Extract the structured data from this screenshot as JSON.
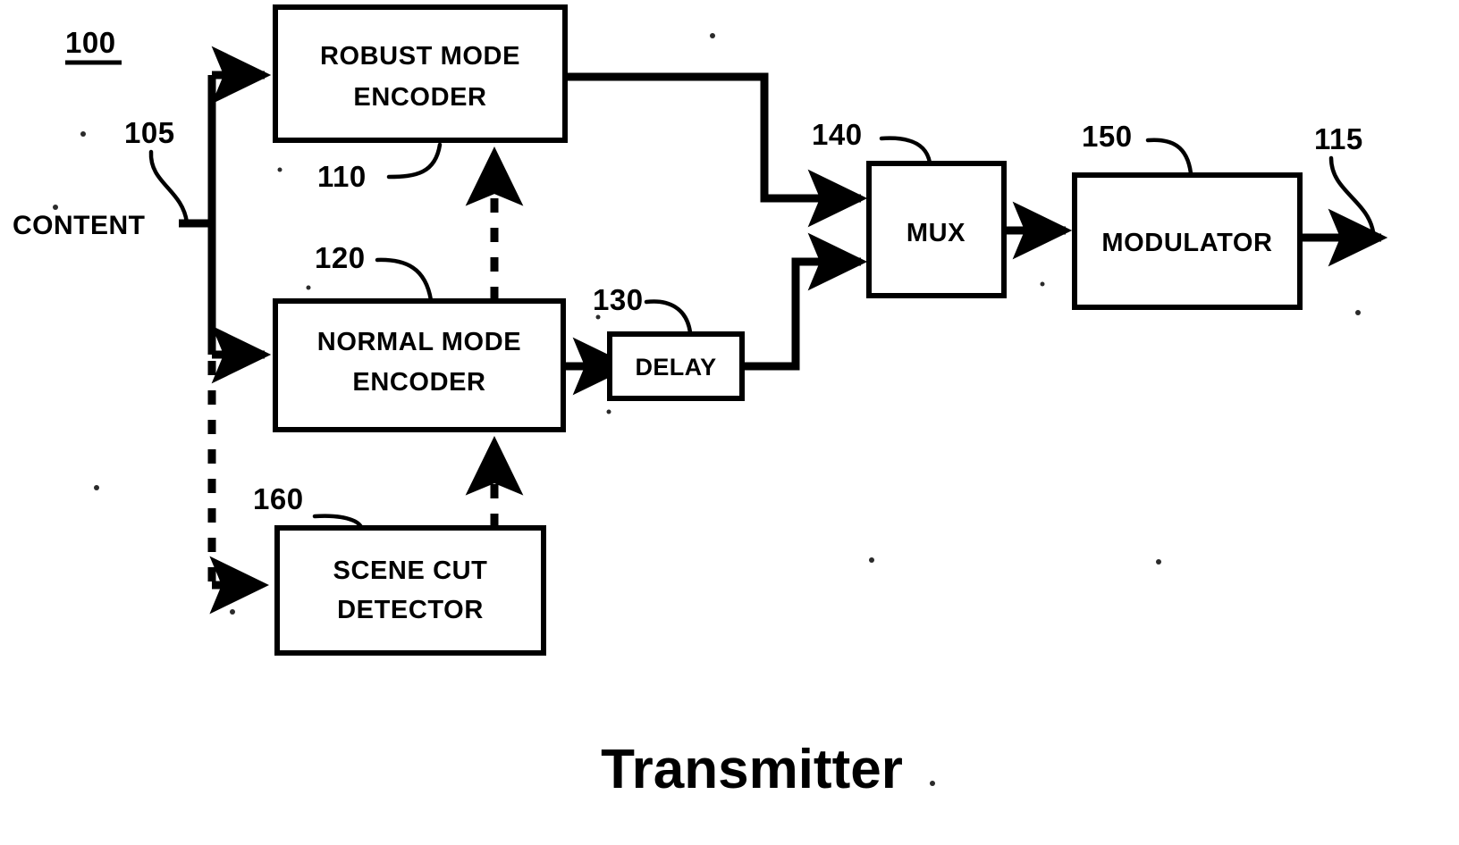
{
  "figure": {
    "caption": "Transmitter",
    "figure_ref": "100"
  },
  "blocks": [
    {
      "id": "robust-mode-encoder",
      "ref": "110",
      "line1": "ROBUST MODE",
      "line2": "ENCODER"
    },
    {
      "id": "normal-mode-encoder",
      "ref": "120",
      "line1": "NORMAL MODE",
      "line2": "ENCODER"
    },
    {
      "id": "scene-cut-detector",
      "ref": "160",
      "line1": "SCENE CUT",
      "line2": "DETECTOR"
    },
    {
      "id": "delay",
      "ref": "130",
      "line1": "DELAY",
      "line2": ""
    },
    {
      "id": "mux",
      "ref": "140",
      "line1": "MUX",
      "line2": ""
    },
    {
      "id": "modulator",
      "ref": "150",
      "line1": "MODULATOR",
      "line2": ""
    }
  ],
  "signals": {
    "input_label": "CONTENT",
    "input_ref": "105",
    "output_ref": "115"
  },
  "colors": {
    "ink": "#000000",
    "paper": "#ffffff"
  }
}
